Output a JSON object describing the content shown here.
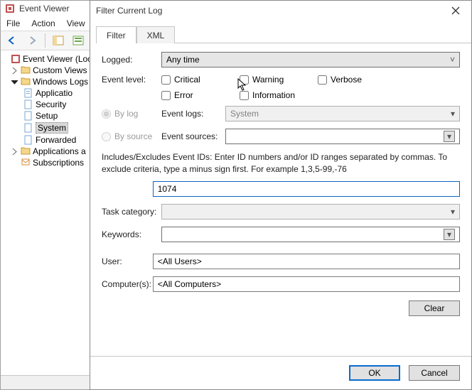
{
  "window": {
    "title": "Event Viewer"
  },
  "menu": {
    "file": "File",
    "action": "Action",
    "view": "View"
  },
  "tree": {
    "root": "Event Viewer (Loc",
    "custom": "Custom Views",
    "winlogs": "Windows Logs",
    "app": "Applicatio",
    "sec": "Security",
    "setup": "Setup",
    "system": "System",
    "fwd": "Forwarded",
    "appsrv": "Applications a",
    "subs": "Subscriptions"
  },
  "dialog": {
    "title": "Filter Current Log",
    "tabs": {
      "filter": "Filter",
      "xml": "XML"
    },
    "logged_label": "Logged:",
    "logged_value": "Any time",
    "level_label": "Event level:",
    "levels": {
      "critical": "Critical",
      "warning": "Warning",
      "verbose": "Verbose",
      "error": "Error",
      "information": "Information"
    },
    "bylog": "By log",
    "bysource": "By source",
    "evlogs_label": "Event logs:",
    "evlogs_value": "System",
    "evsrc_label": "Event sources:",
    "evsrc_value": "",
    "help": "Includes/Excludes Event IDs: Enter ID numbers and/or ID ranges separated by commas. To exclude criteria, type a minus sign first. For example 1,3,5-99,-76",
    "id_value": "1074",
    "task_label": "Task category:",
    "task_value": "",
    "kw_label": "Keywords:",
    "kw_value": "",
    "user_label": "User:",
    "user_value": "<All Users>",
    "comp_label": "Computer(s):",
    "comp_value": "<All Computers>",
    "clear": "Clear",
    "ok": "OK",
    "cancel": "Cancel"
  }
}
